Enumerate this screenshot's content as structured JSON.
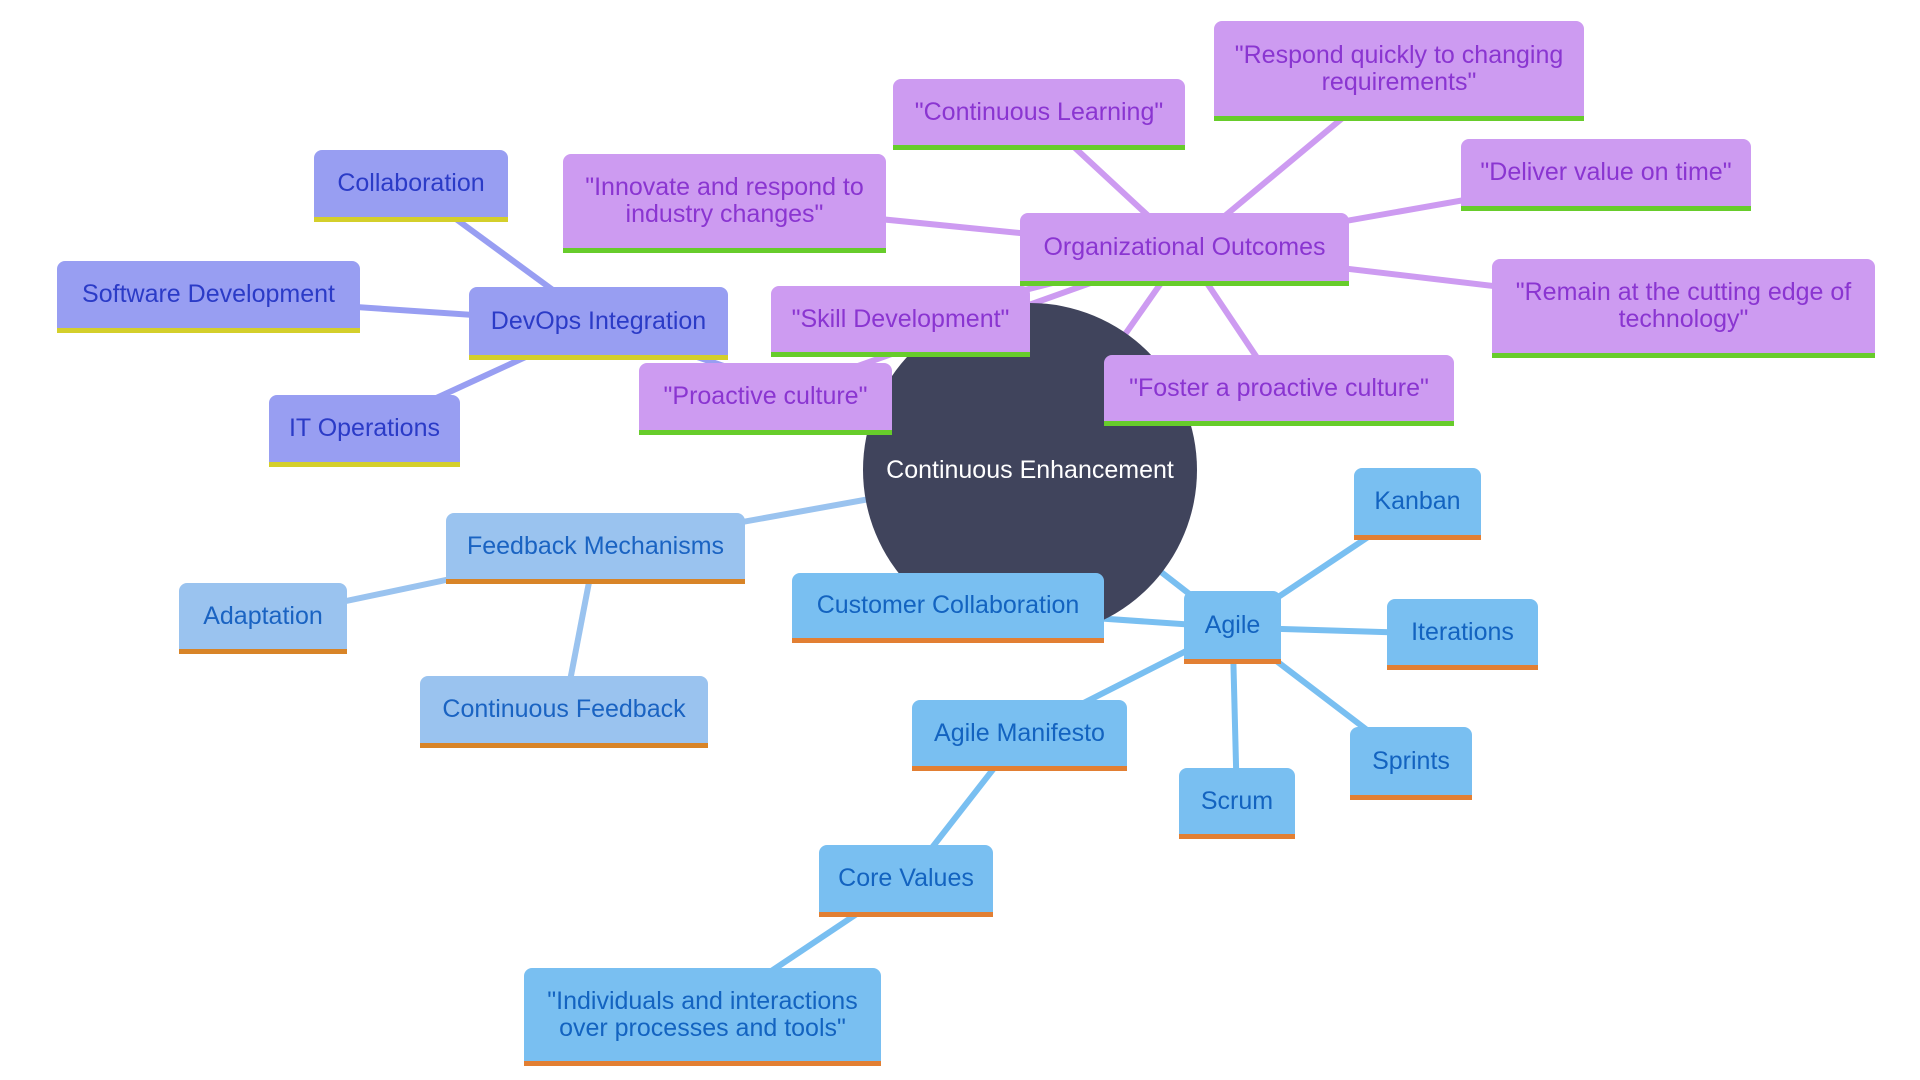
{
  "root": {
    "id": "root",
    "label": "Continuous Enhancement"
  },
  "colors": {
    "root_fill": "#40445c",
    "devops_fill": "#989ef2",
    "devops_text": "#2b3bc7",
    "devops_accent": "#d4cf2b",
    "devops_edge": "#989ef2",
    "org_fill": "#cd9bf1",
    "org_text": "#8a35d1",
    "org_accent": "#67cc2b",
    "org_edge": "#cd9bf1",
    "feedback_fill": "#9ac3ef",
    "feedback_text": "#1a63c2",
    "feedback_accent": "#d88427",
    "feedback_edge": "#9ac3ef",
    "agile_fill": "#79bff1",
    "agile_text": "#1363c0",
    "agile_accent": "#e27f33",
    "agile_edge": "#79bff1"
  },
  "nodes": {
    "devops": {
      "label": "DevOps Integration",
      "parent": "root",
      "branch": "devops"
    },
    "collaboration": {
      "label": "Collaboration",
      "parent": "devops",
      "branch": "devops"
    },
    "software_dev": {
      "label": "Software Development",
      "parent": "devops",
      "branch": "devops"
    },
    "it_ops": {
      "label": "IT Operations",
      "parent": "devops",
      "branch": "devops"
    },
    "org": {
      "label": "Organizational Outcomes",
      "parent": "root",
      "branch": "org"
    },
    "innovate": {
      "label": "\"Innovate and respond to\nindustry changes\"",
      "parent": "org",
      "branch": "org"
    },
    "cont_learning": {
      "label": "\"Continuous Learning\"",
      "parent": "org",
      "branch": "org"
    },
    "respond": {
      "label": "\"Respond quickly to changing\nrequirements\"",
      "parent": "org",
      "branch": "org"
    },
    "deliver": {
      "label": "\"Deliver value on time\"",
      "parent": "org",
      "branch": "org"
    },
    "remain": {
      "label": "\"Remain at the cutting edge of\ntechnology\"",
      "parent": "org",
      "branch": "org"
    },
    "skill_dev": {
      "label": "\"Skill Development\"",
      "parent": "org",
      "branch": "org"
    },
    "proactive": {
      "label": "\"Proactive culture\"",
      "parent": "org",
      "branch": "org"
    },
    "foster": {
      "label": "\"Foster a proactive culture\"",
      "parent": "org",
      "branch": "org"
    },
    "feedback": {
      "label": "Feedback Mechanisms",
      "parent": "root",
      "branch": "feedback"
    },
    "adaptation": {
      "label": "Adaptation",
      "parent": "feedback",
      "branch": "feedback"
    },
    "cont_feedback": {
      "label": "Continuous Feedback",
      "parent": "feedback",
      "branch": "feedback"
    },
    "agile": {
      "label": "Agile",
      "parent": "root",
      "branch": "agile"
    },
    "customer_collab": {
      "label": "Customer Collaboration",
      "parent": "agile",
      "branch": "agile"
    },
    "kanban": {
      "label": "Kanban",
      "parent": "agile",
      "branch": "agile"
    },
    "iterations": {
      "label": "Iterations",
      "parent": "agile",
      "branch": "agile"
    },
    "sprints": {
      "label": "Sprints",
      "parent": "agile",
      "branch": "agile"
    },
    "scrum": {
      "label": "Scrum",
      "parent": "agile",
      "branch": "agile"
    },
    "manifesto": {
      "label": "Agile Manifesto",
      "parent": "agile",
      "branch": "agile"
    },
    "core_values": {
      "label": "Core Values",
      "parent": "manifesto",
      "branch": "agile"
    },
    "individuals": {
      "label": "\"Individuals and interactions\nover processes and tools\"",
      "parent": "core_values",
      "branch": "agile"
    }
  }
}
